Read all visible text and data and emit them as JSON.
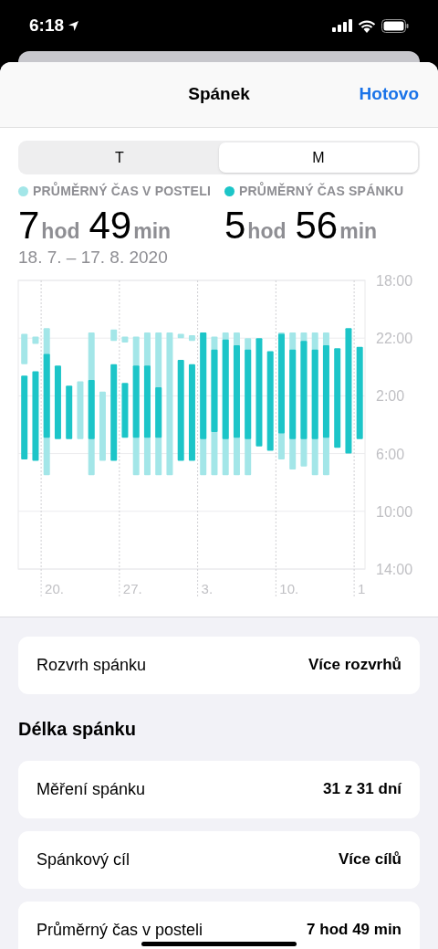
{
  "status_bar": {
    "time": "6:18"
  },
  "header": {
    "title": "Spánek",
    "done": "Hotovo"
  },
  "segments": [
    {
      "label": "T",
      "selected": false
    },
    {
      "label": "M",
      "selected": true
    }
  ],
  "stats": [
    {
      "label": "PRŮMĚRNÝ ČAS V POSTELI",
      "color": "#a3e6e8",
      "hours": "7",
      "hours_unit": "hod",
      "minutes": "49",
      "minutes_unit": "min"
    },
    {
      "label": "PRŮMĚRNÝ ČAS SPÁNKU",
      "color": "#1cc5c8",
      "hours": "5",
      "hours_unit": "hod",
      "minutes": "56",
      "minutes_unit": "min"
    }
  ],
  "date_range": "18. 7. – 17. 8. 2020",
  "chart": {
    "y_labels": [
      "18:00",
      "22:00",
      "2:00",
      "6:00",
      "10:00",
      "14:00"
    ],
    "x_labels": [
      "20.",
      "27.",
      "3.",
      "10.",
      "1"
    ]
  },
  "schedule": {
    "label": "Rozvrh spánku",
    "value": "Více rozvrhů"
  },
  "section_title": "Délka spánku",
  "rows": [
    {
      "label": "Měření spánku",
      "value": "31 z 31 dní"
    },
    {
      "label": "Spánkový cíl",
      "value": "Více cílů"
    },
    {
      "label": "Průměrný čas v posteli",
      "value": "7 hod 49 min"
    }
  ]
}
